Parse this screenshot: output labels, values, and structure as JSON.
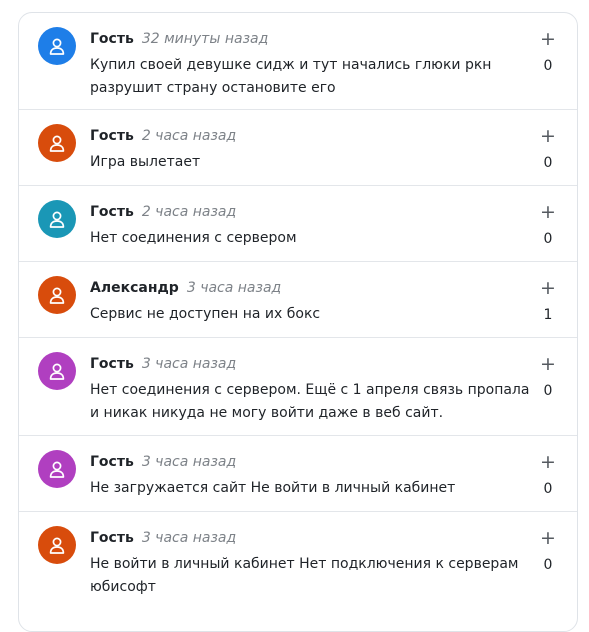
{
  "comments": [
    {
      "author": "Гость",
      "time": "32 минуты назад",
      "text": "Купил своей девушке сидж и тут начались глюки ркн разрушит страну остановите его",
      "plus": "+",
      "votes": "0",
      "avatar_color": "#1e7ee8"
    },
    {
      "author": "Гость",
      "time": "2 часа назад",
      "text": "Игра вылетает",
      "plus": "+",
      "votes": "0",
      "avatar_color": "#d84c0c"
    },
    {
      "author": "Гость",
      "time": "2 часа назад",
      "text": "Нет соединения с сервером",
      "plus": "+",
      "votes": "0",
      "avatar_color": "#1a97b6"
    },
    {
      "author": "Александр",
      "time": "3 часа назад",
      "text": "Сервис не доступен на их бокс",
      "plus": "+",
      "votes": "1",
      "avatar_color": "#d84c0c"
    },
    {
      "author": "Гость",
      "time": "3 часа назад",
      "text": "Нет соединения с сервером. Ещё с 1 апреля связь пропала и никак никуда не могу войти даже в веб сайт.",
      "plus": "+",
      "votes": "0",
      "avatar_color": "#b03fc0"
    },
    {
      "author": "Гость",
      "time": "3 часа назад",
      "text": "Не загружается сайт Не войти в личный кабинет",
      "plus": "+",
      "votes": "0",
      "avatar_color": "#b03fc0"
    },
    {
      "author": "Гость",
      "time": "3 часа назад",
      "text": "Не войти в личный кабинет Нет подключения к серверам юбисофт",
      "plus": "+",
      "votes": "0",
      "avatar_color": "#d84c0c"
    }
  ],
  "icons": {
    "avatar": "user-icon"
  }
}
